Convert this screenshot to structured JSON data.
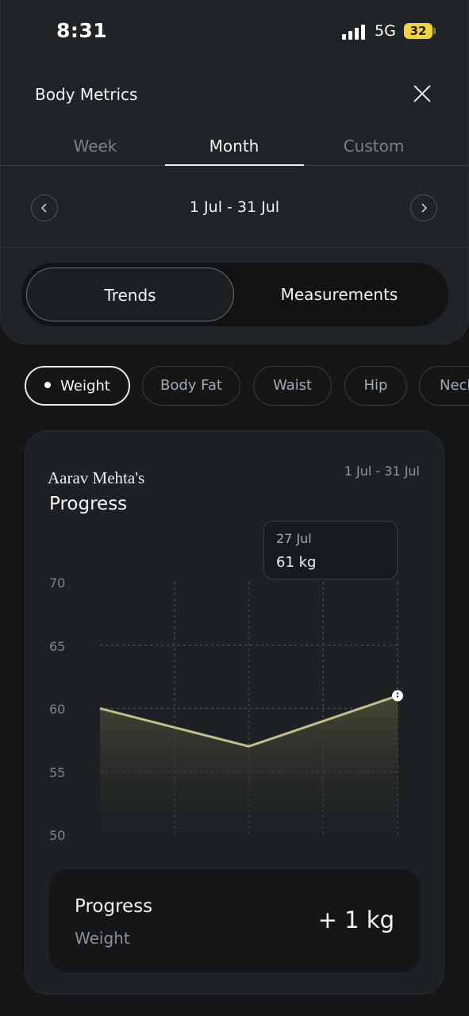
{
  "status": {
    "time": "8:31",
    "network": "5G",
    "battery": "32"
  },
  "header": {
    "title": "Body Metrics"
  },
  "tabs": [
    {
      "label": "Week",
      "active": false
    },
    {
      "label": "Month",
      "active": true
    },
    {
      "label": "Custom",
      "active": false
    }
  ],
  "range": {
    "label": "1 Jul - 31 Jul"
  },
  "segments": {
    "active": "Trends",
    "inactive": "Measurements"
  },
  "chips": [
    {
      "label": "Weight",
      "active": true
    },
    {
      "label": "Body Fat",
      "active": false
    },
    {
      "label": "Waist",
      "active": false
    },
    {
      "label": "Hip",
      "active": false
    },
    {
      "label": "Neck",
      "active": false
    }
  ],
  "card": {
    "owner": "Aarav Mehta's",
    "title": "Progress",
    "range": "1 Jul - 31 Jul",
    "tooltip": {
      "date": "27 Jul",
      "value": "61 kg"
    }
  },
  "chart_data": {
    "type": "area",
    "y_ticks": [
      "70",
      "65",
      "60",
      "55",
      "50"
    ],
    "ylim": [
      50,
      70
    ],
    "series": [
      {
        "values": [
          60,
          57,
          61
        ]
      }
    ],
    "grid": true,
    "colors": {
      "line": "#bfc08a",
      "fill": "#4a4c36"
    }
  },
  "summary": {
    "title": "Progress",
    "subtitle": "Weight",
    "value": "+ 1 kg"
  },
  "icons": {
    "close": "close-icon",
    "prev": "chevron-left-icon",
    "next": "chevron-right-icon",
    "signal": "signal-icon",
    "battery": "battery-icon"
  }
}
